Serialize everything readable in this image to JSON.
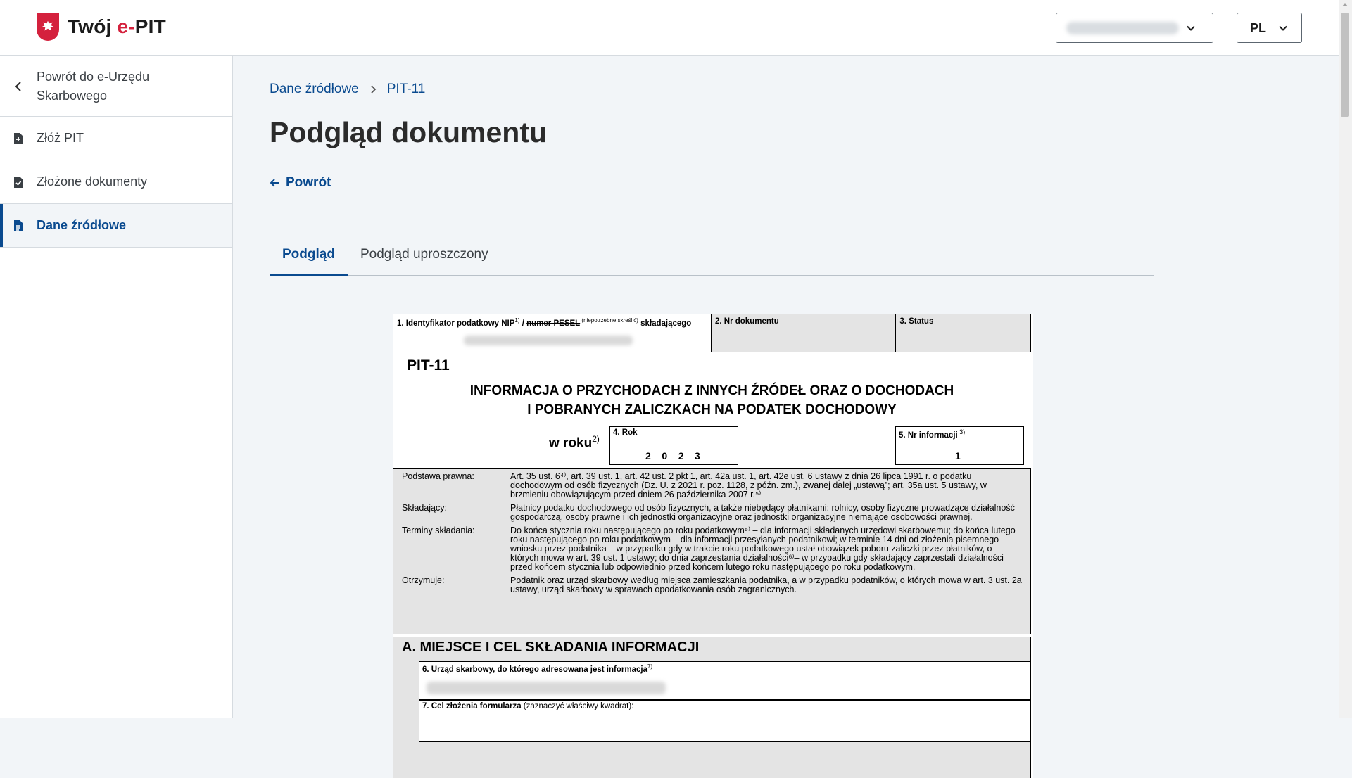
{
  "header": {
    "logo_main": "Twój ",
    "logo_accent": "e-",
    "logo_end": "PIT",
    "lang": "PL"
  },
  "sidebar": {
    "back_label": "Powrót do e-Urzędu Skarbowego",
    "items": [
      {
        "label": "Złóż PIT"
      },
      {
        "label": "Złożone dokumenty"
      },
      {
        "label": "Dane źródłowe"
      }
    ]
  },
  "breadcrumb": {
    "root": "Dane źródłowe",
    "current": "PIT-11"
  },
  "page": {
    "title": "Podgląd dokumentu",
    "back": "Powrót"
  },
  "tabs": [
    {
      "label": "Podgląd"
    },
    {
      "label": "Podgląd uproszczony"
    }
  ],
  "doc": {
    "f1_a": "1. Identyfikator podatkowy NIP",
    "f1_sup1": "1)",
    "f1_slash": " / ",
    "f1_strike": "numer PESEL",
    "f1_note": " (niepotrzebne skreślić)",
    "f1_end": " składającego",
    "f2": "2. Nr dokumentu",
    "f3": "3. Status",
    "form_name": "PIT-11",
    "title_line1": "INFORMACJA O PRZYCHODACH Z INNYCH ŹRÓDEŁ ORAZ O DOCHODACH",
    "title_line2": "I POBRANYCH ZALICZKACH NA PODATEK DOCHODOWY",
    "w_roku": "w roku",
    "w_roku_sup": "2)",
    "f4": "4. Rok",
    "f4_val": "2    0    2    3",
    "f5": "5. Nr informacji",
    "f5_sup": " 3)",
    "f5_val": "1",
    "legal": [
      {
        "k": "Podstawa prawna:",
        "v": "Art. 35 ust. 6⁴⁾, art. 39 ust. 1, art. 42 ust. 2 pkt 1, art. 42a ust. 1, art. 42e ust. 6 ustawy z dnia 26 lipca 1991 r. o podatku dochodowym od osób fizycznych (Dz. U. z 2021 r. poz. 1128, z późn. zm.), zwanej dalej „ustawą”; art. 35a ust. 5 ustawy, w brzmieniu obowiązującym przed dniem 26 października 2007 r.⁵⁾"
      },
      {
        "k": "Składający:",
        "v": "Płatnicy podatku dochodowego od osób fizycznych, a także niebędący płatnikami: rolnicy, osoby fizyczne prowadzące działalność gospodarczą, osoby prawne i ich jednostki organizacyjne oraz jednostki organizacyjne niemające osobowości prawnej."
      },
      {
        "k": "Terminy składania:",
        "v": "Do końca stycznia roku następującego po roku podatkowym⁵⁾ – dla informacji składanych urzędowi skarbowemu; do końca lutego roku następującego po roku podatkowym – dla informacji przesyłanych podatnikowi; w terminie 14 dni od złożenia pisemnego wniosku przez podatnika – w przypadku gdy w trakcie roku podatkowego ustał obowiązek poboru zaliczki przez płatników, o których mowa w art. 39 ust. 1 ustawy; do dnia zaprzestania działalności⁶⁾– w przypadku gdy składający zaprzestali działalności przed końcem stycznia lub odpowiednio przed końcem lutego roku następującego po roku podatkowym."
      },
      {
        "k": "Otrzymuje:",
        "v": "Podatnik oraz urząd skarbowy według miejsca zamieszkania podatnika, a w przypadku podatników, o których mowa w art. 3 ust. 2a ustawy, urząd skarbowy w sprawach opodatkowania osób zagranicznych."
      }
    ],
    "sec_a_title": "A. MIEJSCE I CEL SKŁADANIA INFORMACJI",
    "f6": "6. Urząd skarbowy, do którego adresowana jest informacja",
    "f6_sup": "7)",
    "f7": "7. Cel złożenia formularza",
    "f7_note": " (zaznaczyć właściwy kwadrat):"
  }
}
